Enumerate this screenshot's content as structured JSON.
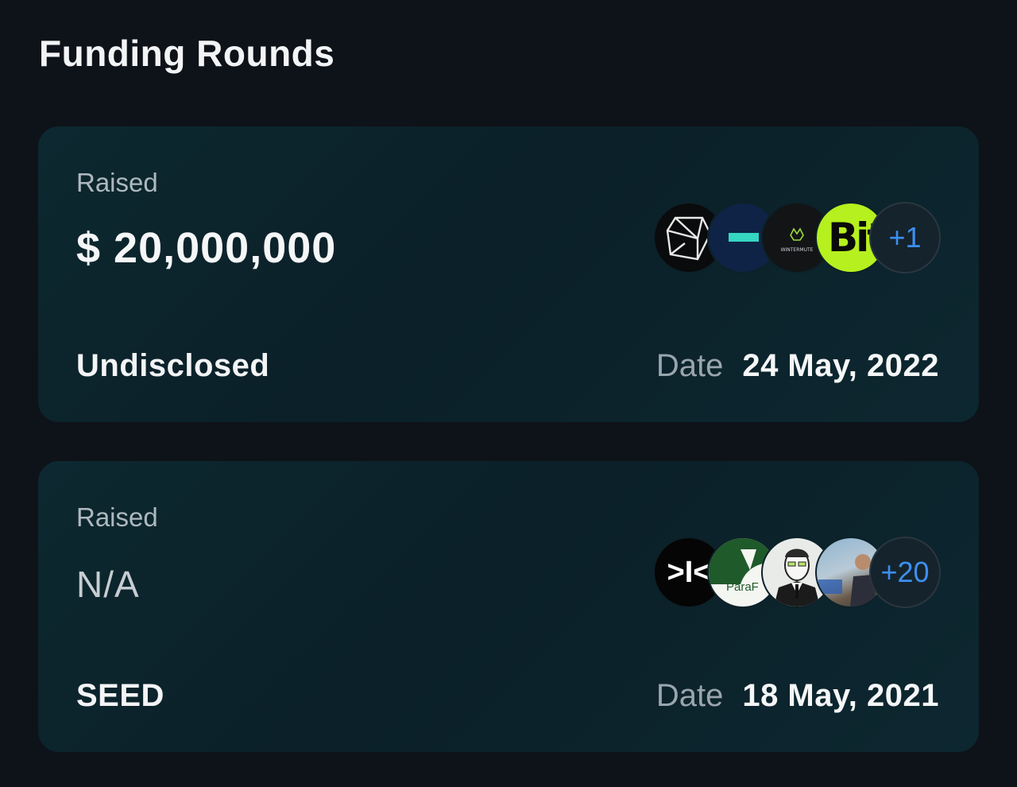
{
  "page": {
    "title": "Funding Rounds"
  },
  "rounds": [
    {
      "raised_label": "Raised",
      "amount": "$ 20,000,000",
      "round_type": "Undisclosed",
      "date_label": "Date",
      "date": "24 May, 2022",
      "investors": [
        {
          "icon": "geometric-cube-logo"
        },
        {
          "icon": "teal-dash-logo"
        },
        {
          "icon": "wintermute-logo",
          "text": "WINTERMUTE"
        },
        {
          "icon": "bit-logo",
          "text": "Bit"
        }
      ],
      "more_count": "+1"
    },
    {
      "raised_label": "Raised",
      "amount": "N/A",
      "round_type": "SEED",
      "date_label": "Date",
      "date": "18 May, 2021",
      "investors": [
        {
          "icon": "prompt-logo",
          "text": ">I<"
        },
        {
          "icon": "paraf-logo",
          "text": "ParaF"
        },
        {
          "icon": "man-portrait-avatar"
        },
        {
          "icon": "person-photo-avatar"
        }
      ],
      "more_count": "+20"
    }
  ],
  "colors": {
    "background": "#0e1219",
    "card": "#0b2028",
    "accent_blue": "#3d8ff0",
    "bit_green": "#b6f01e"
  }
}
